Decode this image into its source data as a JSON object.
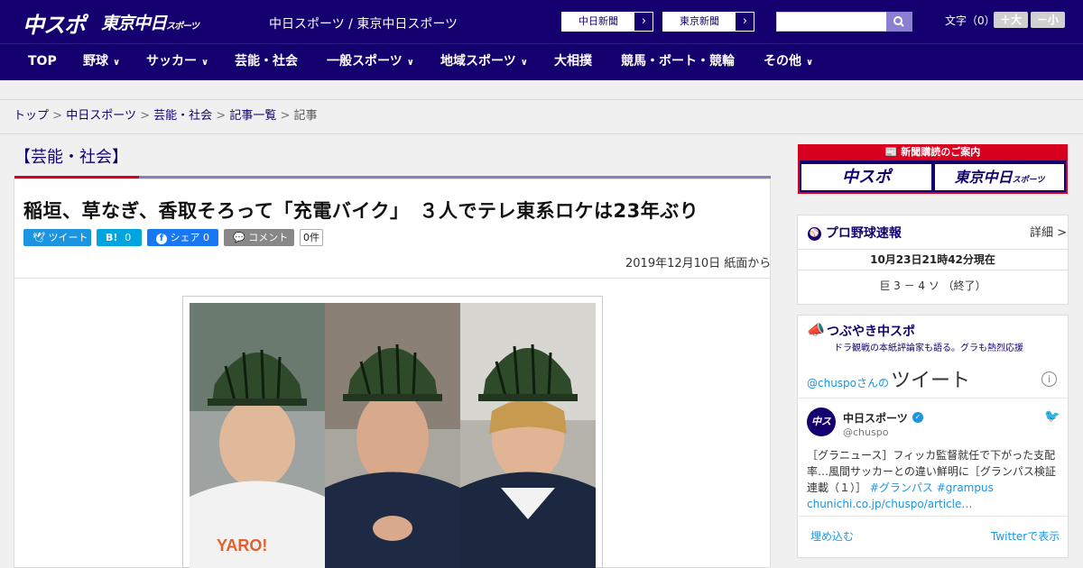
{
  "header": {
    "logo_chuspo": "中スポ",
    "logo_tokyo": "東京中日",
    "logo_tokyo_small": "スポーツ",
    "site_name": "中日スポーツ / 東京中日スポーツ",
    "paper_links": [
      "中日新聞",
      "東京新聞"
    ],
    "search_placeholder": "",
    "font_size_label": "文字（0）",
    "font_bigger": "＋大",
    "font_smaller": "－小"
  },
  "nav": {
    "items": [
      {
        "label": "TOP",
        "has_dropdown": false
      },
      {
        "label": "野球",
        "has_dropdown": true
      },
      {
        "label": "サッカー",
        "has_dropdown": true
      },
      {
        "label": "芸能・社会",
        "has_dropdown": false
      },
      {
        "label": "一般スポーツ",
        "has_dropdown": true
      },
      {
        "label": "地域スポーツ",
        "has_dropdown": true
      },
      {
        "label": "大相撲",
        "has_dropdown": false
      },
      {
        "label": "競馬・ボート・競輪",
        "has_dropdown": false
      },
      {
        "label": "その他",
        "has_dropdown": true
      }
    ],
    "chevron": "∨"
  },
  "breadcrumb": {
    "items": [
      "トップ",
      "中日スポーツ",
      "芸能・社会",
      "記事一覧"
    ],
    "current": "記事",
    "separator": ">"
  },
  "article": {
    "section": "【芸能・社会】",
    "headline": "稲垣、草なぎ、香取そろって「充電バイク」　３人でテレ東系ロケは23年ぶり",
    "share": {
      "tweet": "ツイート",
      "hatena": "B!",
      "hatena_count": "0",
      "facebook": "シェア",
      "facebook_count": "0",
      "comment": "コメント",
      "comment_count": "0件"
    },
    "date": "2019年12月10日 紙面から"
  },
  "sidebar": {
    "ad_title": "新聞購読のご案内",
    "ad_logo_chuspo": "中スポ",
    "ad_logo_tokyo": "東京中日",
    "ad_logo_tokyo_small": "スポーツ",
    "baseball": {
      "title": "プロ野球速報",
      "detail": "詳細 >",
      "timestamp": "10月23日21時42分現在",
      "score": "巨 3 － 4 ソ （終了）"
    },
    "twitter": {
      "title": "つぶやき中スポ",
      "subtitle": "ドラ観戦の本紙評論家も語る。グラも熱烈応援",
      "header_prefix": "@chuspoさんの",
      "header_big": "ツイート",
      "info": "i",
      "account_name": "中日スポーツ",
      "verified": "✓",
      "handle": "@chuspo",
      "tweet_text": "［グラニュース］フィッカ監督就任で下がった支配率…風間サッカーとの違い鮮明に［グランパス検証連載（１）］",
      "hashtags": "#グランパス #grampus",
      "link": "chunichi.co.jp/chuspo/article…",
      "embed": "埋め込む",
      "view_on_twitter": "Twitterで表示"
    }
  },
  "colors": {
    "brand_navy": "#14006e",
    "accent_red": "#d7001f",
    "twitter_blue": "#1b95e0",
    "facebook_blue": "#1877f2",
    "hatena_blue": "#00a4de"
  }
}
